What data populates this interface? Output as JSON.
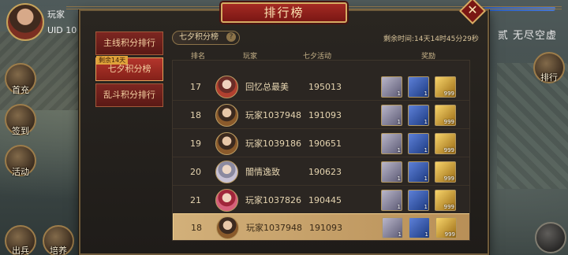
{
  "player": {
    "name": "玩家",
    "uid": "UID 10"
  },
  "hud": {
    "right_title": "贰 无尽空虚",
    "left_buttons": [
      "首充",
      "签到",
      "活动",
      "出兵",
      "培养"
    ],
    "right_button": "排行"
  },
  "panel": {
    "title": "排行榜",
    "close_icon": "close-x-icon",
    "close_glyph": "✕"
  },
  "tabs": [
    {
      "label": "主线积分排行",
      "active": false
    },
    {
      "label": "七夕积分榜",
      "active": true,
      "badge": "剩余14天"
    },
    {
      "label": "乱斗积分排行",
      "active": false
    }
  ],
  "section": {
    "title": "七夕积分榜",
    "help": "?",
    "countdown": "剩余时间:14天14时45分29秒"
  },
  "columns": [
    "排名",
    "玩家",
    "七夕活动",
    "奖励"
  ],
  "rows": [
    {
      "rank": "17",
      "name": "回忆总最美",
      "score": "195013",
      "avatar": "alt"
    },
    {
      "rank": "18",
      "name": "玩家1037948",
      "score": "191093",
      "avatar": "default"
    },
    {
      "rank": "19",
      "name": "玩家1039186",
      "score": "190651",
      "avatar": "default"
    },
    {
      "rank": "20",
      "name": "闇情逸致",
      "score": "190623",
      "avatar": "alt2"
    },
    {
      "rank": "21",
      "name": "玩家1037826",
      "score": "190445",
      "avatar": "alt3"
    }
  ],
  "self_row": {
    "rank": "18",
    "name": "玩家1037948",
    "score": "191093",
    "avatar": "default"
  },
  "rewards": [
    {
      "kind": "armor",
      "count": "1"
    },
    {
      "kind": "book",
      "count": "1"
    },
    {
      "kind": "gold",
      "count": "999"
    }
  ],
  "colors": {
    "accent_red": "#a52a23",
    "gold_border": "#d5ac63",
    "self_highlight": "#d2b07a"
  }
}
